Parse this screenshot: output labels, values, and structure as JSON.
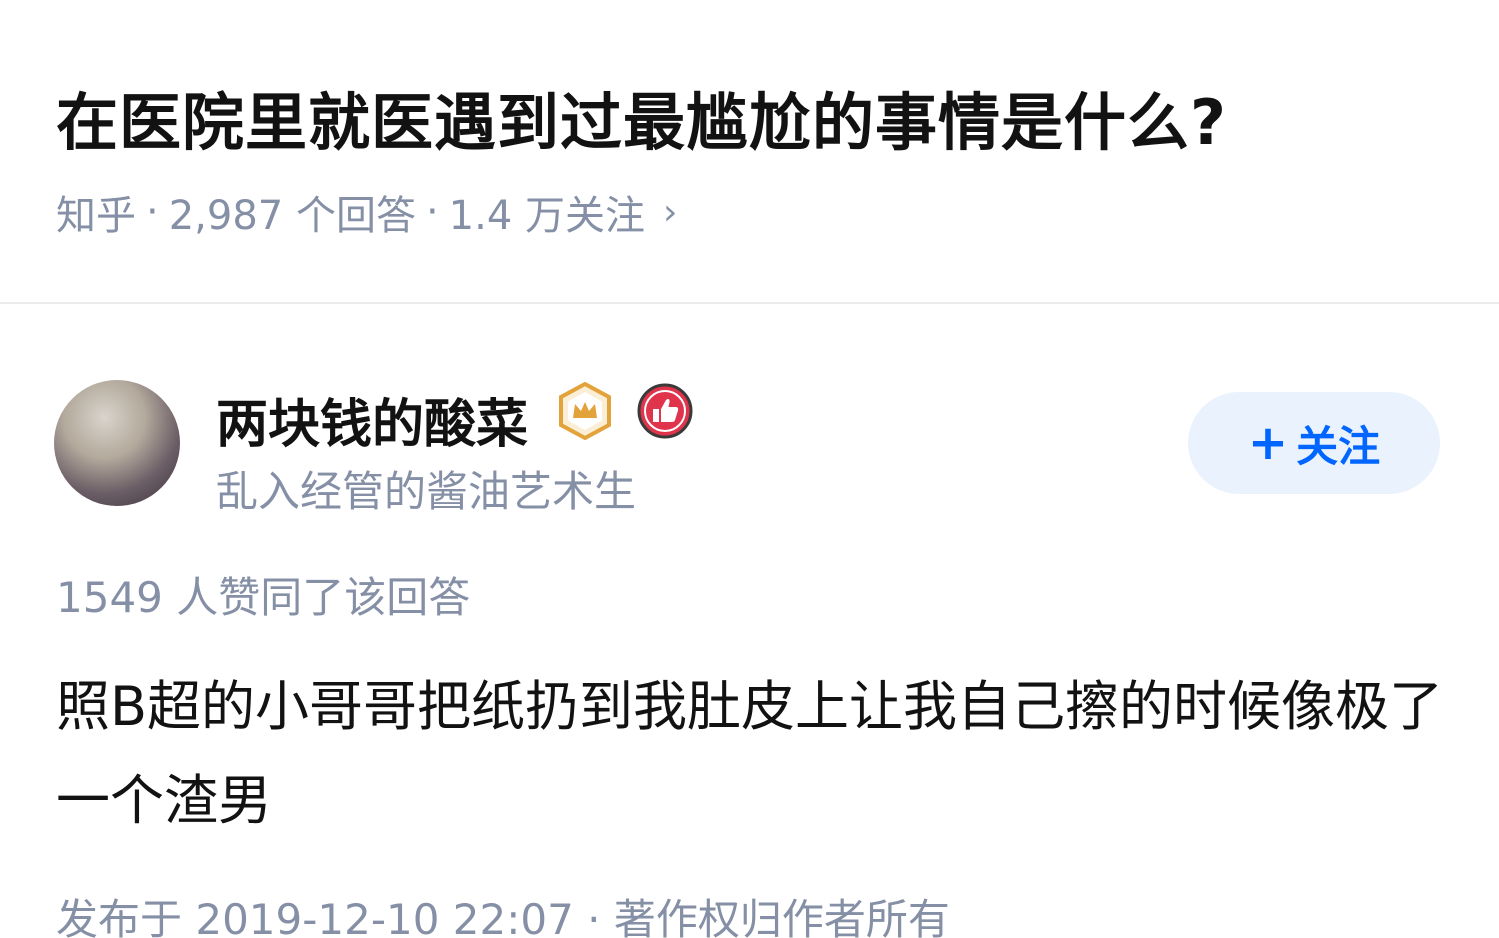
{
  "question": {
    "title": "在医院里就医遇到过最尴尬的事情是什么?",
    "source": "知乎",
    "answers_count": "2,987 个回答",
    "followers": "1.4 万关注",
    "separator": "·",
    "chevron": "›"
  },
  "author": {
    "name": "两块钱的酸菜",
    "bio": "乱入经管的酱油艺术生",
    "badges": [
      "crown-badge-icon",
      "thumbs-up-badge-icon"
    ],
    "follow_label": "关注",
    "follow_plus": "+"
  },
  "answer": {
    "votes": "1549 人赞同了该回答",
    "content": "照B超的小哥哥把纸扔到我肚皮上让我自己擦的时候像极了一个渣男",
    "footer": "发布于 2019-12-10 22:07 · 著作权归作者所有"
  },
  "colors": {
    "text_primary": "#121212",
    "text_secondary": "#8590a6",
    "accent_blue": "#0066ff",
    "follow_bg": "#eaf2fd",
    "crown_gold": "#e3a33b",
    "like_red": "#e0344c"
  }
}
